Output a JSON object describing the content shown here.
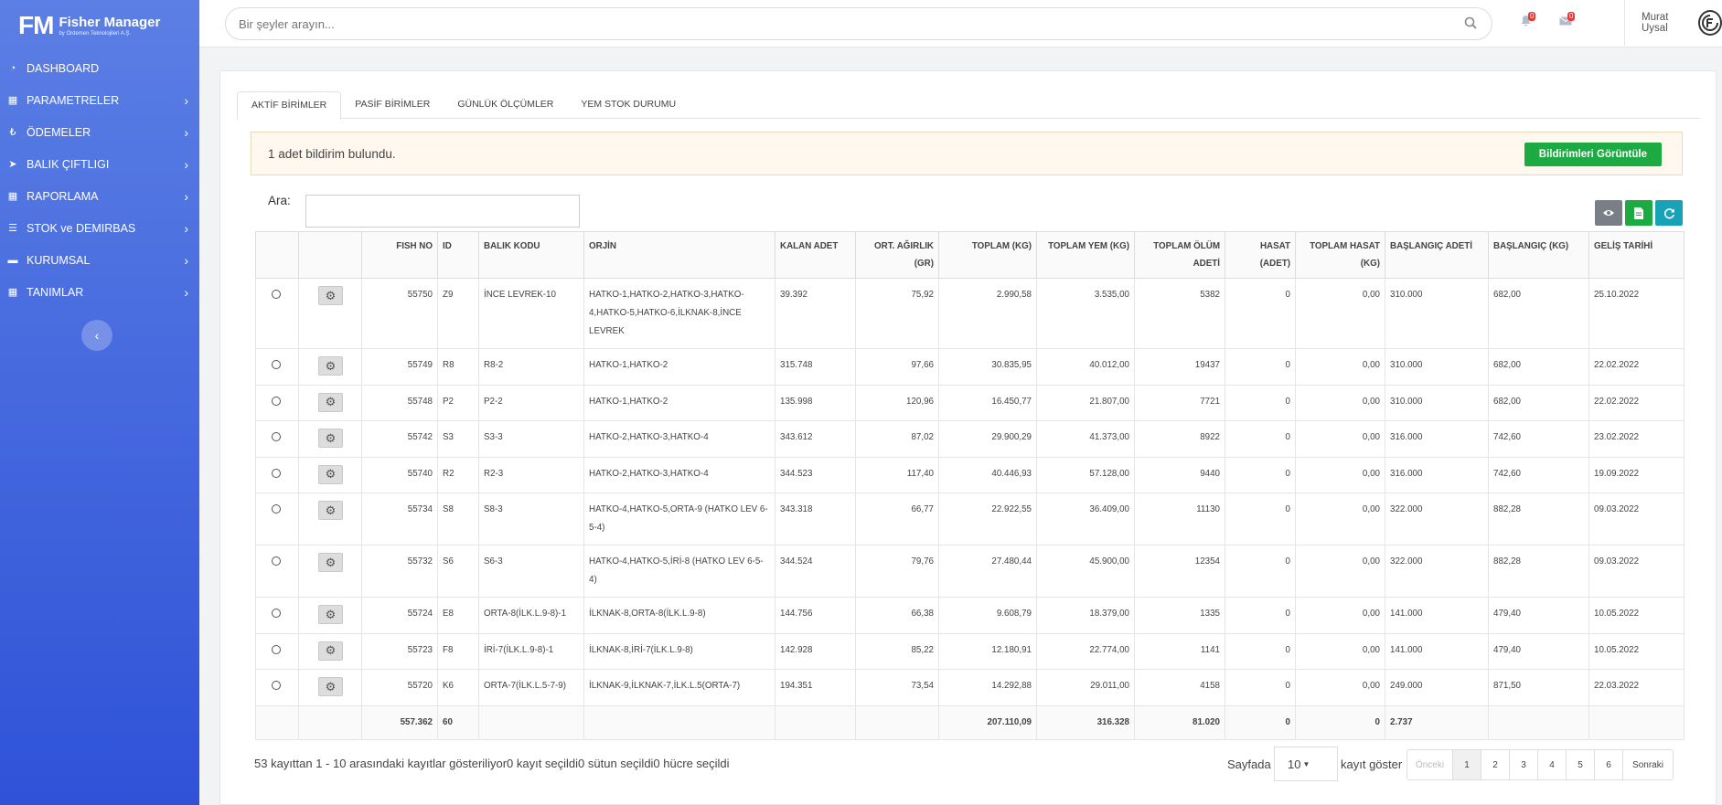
{
  "brand": {
    "mark": "FM",
    "title": "Fisher Manager",
    "subtitle": "by Ördemen Teknolojileri A.Ş."
  },
  "sidebar": {
    "items": [
      {
        "label": "DASHBOARD",
        "icon": "dashboard-icon",
        "glyph": "◔",
        "has_chevron": false
      },
      {
        "label": "PARAMETRELER",
        "icon": "table-icon",
        "glyph": "▦",
        "has_chevron": true
      },
      {
        "label": "ÖDEMELER",
        "icon": "payment-icon",
        "glyph": "₺",
        "has_chevron": true
      },
      {
        "label": "BALIK ÇIFTLIGI",
        "icon": "fish-icon",
        "glyph": "➤",
        "has_chevron": true
      },
      {
        "label": "RAPORLAMA",
        "icon": "table-icon",
        "glyph": "▦",
        "has_chevron": true
      },
      {
        "label": "STOK ve DEMIRBAS",
        "icon": "list-icon",
        "glyph": "☰",
        "has_chevron": true
      },
      {
        "label": "KURUMSAL",
        "icon": "folder-icon",
        "glyph": "▬",
        "has_chevron": true
      },
      {
        "label": "TANIMLAR",
        "icon": "table-icon",
        "glyph": "▦",
        "has_chevron": true
      }
    ],
    "collapse_glyph": "‹"
  },
  "topbar": {
    "search_placeholder": "Bir şeyler arayın...",
    "notifications_count": "0",
    "messages_count": "0",
    "user_name": "Murat Uysal"
  },
  "tabs": [
    "AKTİF BİRİMLER",
    "PASİF BİRİMLER",
    "GÜNLÜK ÖLÇÜMLER",
    "YEM STOK DURUMU"
  ],
  "alert": {
    "text": "1 adet bildirim bulundu.",
    "button": "Bildirimleri Görüntüle"
  },
  "search_label": "Ara:",
  "toolbar_colors": {
    "view": "#7a7f87",
    "excel": "#1eaa42",
    "refresh": "#17a2b8"
  },
  "table": {
    "headers": [
      "",
      "",
      "FISH NO",
      "ID",
      "BALIK KODU",
      "ORJİN",
      "KALAN ADET",
      "ORT. AĞIRLIK (GR)",
      "TOPLAM (KG)",
      "TOPLAM YEM (KG)",
      "TOPLAM ÖLÜM ADETİ",
      "HASAT (ADET)",
      "TOPLAM HASAT (KG)",
      "BAŞLANGIÇ ADETİ",
      "BAŞLANGIÇ (KG)",
      "GELİŞ TARİHİ"
    ],
    "rows": [
      [
        "55750",
        "Z9",
        "İNCE LEVREK-10",
        "HATKO-1,HATKO-2,HATKO-3,HATKO-4,HATKO-5,HATKO-6,İLKNAK-8,İNCE LEVREK",
        "39.392",
        "75,92",
        "2.990,58",
        "3.535,00",
        "5382",
        "0",
        "0,00",
        "310.000",
        "682,00",
        "25.10.2022"
      ],
      [
        "55749",
        "R8",
        "R8-2",
        "HATKO-1,HATKO-2",
        "315.748",
        "97,66",
        "30.835,95",
        "40.012,00",
        "19437",
        "0",
        "0,00",
        "310.000",
        "682,00",
        "22.02.2022"
      ],
      [
        "55748",
        "P2",
        "P2-2",
        "HATKO-1,HATKO-2",
        "135.998",
        "120,96",
        "16.450,77",
        "21.807,00",
        "7721",
        "0",
        "0,00",
        "310.000",
        "682,00",
        "22.02.2022"
      ],
      [
        "55742",
        "S3",
        "S3-3",
        "HATKO-2,HATKO-3,HATKO-4",
        "343.612",
        "87,02",
        "29.900,29",
        "41.373,00",
        "8922",
        "0",
        "0,00",
        "316.000",
        "742,60",
        "23.02.2022"
      ],
      [
        "55740",
        "R2",
        "R2-3",
        "HATKO-2,HATKO-3,HATKO-4",
        "344.523",
        "117,40",
        "40.446,93",
        "57.128,00",
        "9440",
        "0",
        "0,00",
        "316.000",
        "742,60",
        "19.09.2022"
      ],
      [
        "55734",
        "S8",
        "S8-3",
        "HATKO-4,HATKO-5,ORTA-9 (HATKO LEV 6-5-4)",
        "343.318",
        "66,77",
        "22.922,55",
        "36.409,00",
        "11130",
        "0",
        "0,00",
        "322.000",
        "882,28",
        "09.03.2022"
      ],
      [
        "55732",
        "S6",
        "S6-3",
        "HATKO-4,HATKO-5,İRİ-8 (HATKO LEV 6-5-4)",
        "344.524",
        "79,76",
        "27.480,44",
        "45.900,00",
        "12354",
        "0",
        "0,00",
        "322.000",
        "882,28",
        "09.03.2022"
      ],
      [
        "55724",
        "E8",
        "ORTA-8(İLK.L.9-8)-1",
        "İLKNAK-8,ORTA-8(İLK.L.9-8)",
        "144.756",
        "66,38",
        "9.608,79",
        "18.379,00",
        "1335",
        "0",
        "0,00",
        "141.000",
        "479,40",
        "10.05.2022"
      ],
      [
        "55723",
        "F8",
        "İRİ-7(İLK.L.9-8)-1",
        "İLKNAK-8,İRİ-7(İLK.L.9-8)",
        "142.928",
        "85,22",
        "12.180,91",
        "22.774,00",
        "1141",
        "0",
        "0,00",
        "141.000",
        "479,40",
        "10.05.2022"
      ],
      [
        "55720",
        "K6",
        "ORTA-7(İLK.L.5-7-9)",
        "İLKNAK-9,İLKNAK-7,İLK.L.5(ORTA-7)",
        "194.351",
        "73,54",
        "14.292,88",
        "29.011,00",
        "4158",
        "0",
        "0,00",
        "249.000",
        "871,50",
        "22.03.2022"
      ]
    ],
    "footer": [
      "",
      "",
      "557.362",
      "60",
      "",
      "",
      "",
      "",
      "207.110,09",
      "316.328",
      "81.020",
      "0",
      "0",
      "2.737",
      "",
      ""
    ]
  },
  "pagination": {
    "info": "53 kayıttan 1 - 10 arasındaki kayıtlar gösteriliyor0 kayıt seçildi0 sütun seçildi0 hücre seçildi",
    "sayfada": "Sayfada",
    "page_size": "10",
    "kayit_goster": "kayıt göster",
    "prev": "Önceki",
    "pages": [
      "1",
      "2",
      "3",
      "4",
      "5",
      "6"
    ],
    "next": "Sonraki"
  }
}
